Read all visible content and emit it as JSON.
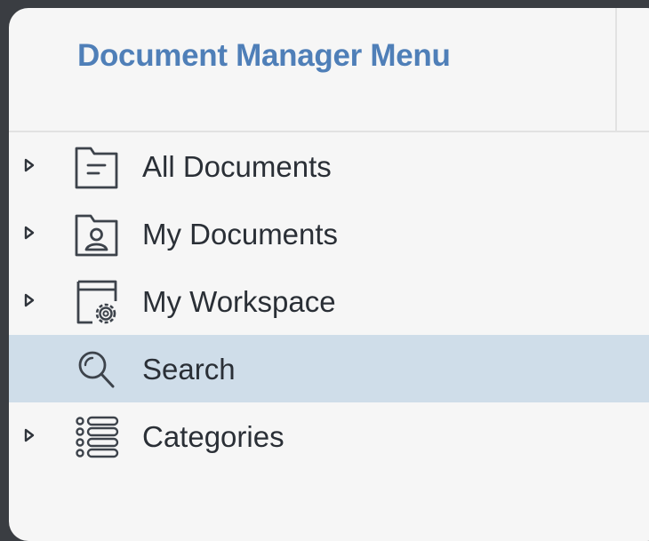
{
  "header": {
    "title": "Document Manager Menu"
  },
  "menu": {
    "items": [
      {
        "label": "All Documents",
        "icon": "document-folder-icon",
        "expandable": true,
        "selected": false
      },
      {
        "label": "My Documents",
        "icon": "user-folder-icon",
        "expandable": true,
        "selected": false
      },
      {
        "label": "My Workspace",
        "icon": "workspace-gear-icon",
        "expandable": true,
        "selected": false
      },
      {
        "label": "Search",
        "icon": "search-icon",
        "expandable": false,
        "selected": true
      },
      {
        "label": "Categories",
        "icon": "list-icon",
        "expandable": true,
        "selected": false
      }
    ]
  },
  "colors": {
    "title": "#4f7fb8",
    "selected_background": "#cfdde9",
    "panel_background": "#f6f6f6",
    "outer_background": "#3a3d42",
    "text": "#2a2f36",
    "icon_stroke": "#3d434b"
  }
}
